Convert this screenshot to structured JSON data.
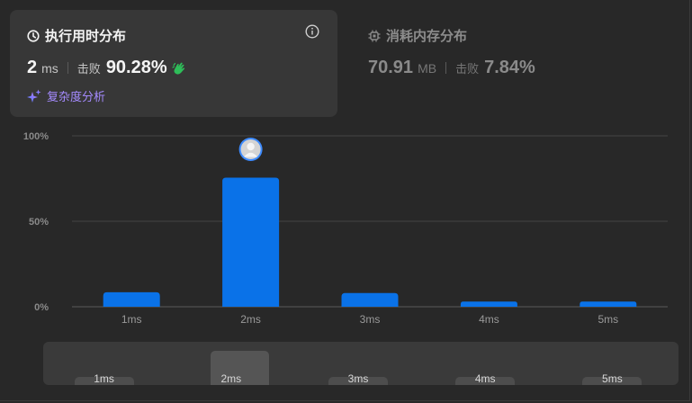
{
  "runtime_card": {
    "title": "执行用时分布",
    "value": "2",
    "unit": "ms",
    "beats_label": "击败",
    "beats_value": "90.28%",
    "complexity_link": "复杂度分析"
  },
  "memory_card": {
    "title": "消耗内存分布",
    "value": "70.91",
    "unit": "MB",
    "beats_label": "击败",
    "beats_value": "7.84%"
  },
  "colors": {
    "bar": "#0a72e8",
    "accent_purple": "#a58bff",
    "clap_green": "#2ebd59"
  },
  "chart_data": {
    "type": "bar",
    "categories": [
      "1ms",
      "2ms",
      "3ms",
      "4ms",
      "5ms"
    ],
    "values": [
      8.5,
      75.5,
      8,
      3,
      3
    ],
    "y_ticks": [
      "100%",
      "50%",
      "0%"
    ],
    "ylim": [
      0,
      100
    ],
    "grid": true,
    "highlighted_category": "2ms"
  },
  "scrubber": {
    "labels": [
      "1ms",
      "2ms",
      "3ms",
      "4ms",
      "5ms"
    ],
    "selected": "2ms"
  }
}
